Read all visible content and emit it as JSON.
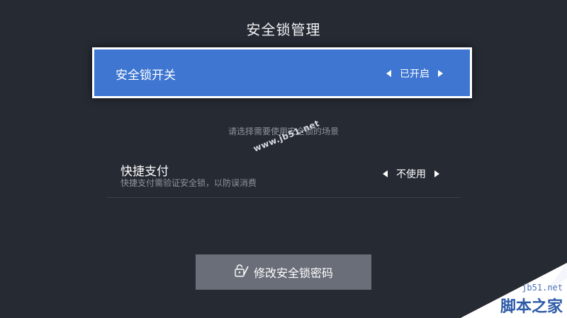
{
  "title": "安全锁管理",
  "lock_switch": {
    "label": "安全锁开关",
    "value": "已开启"
  },
  "hint": "请选择需要使用安全锁的场景",
  "quick_pay": {
    "label": "快捷支付",
    "description": "快捷支付需验证安全锁，以防误消费",
    "value": "不使用"
  },
  "change_password": {
    "label": "修改安全锁密码",
    "icon": "lock-edit-icon"
  },
  "watermark": "www.jb51.net",
  "corner_badge": {
    "site": "jb51.net",
    "brand": "脚本之家"
  },
  "colors": {
    "background": "#262a33",
    "focused": "#3e76d1",
    "button": "#6a6e78",
    "muted_text": "#8e939c"
  }
}
